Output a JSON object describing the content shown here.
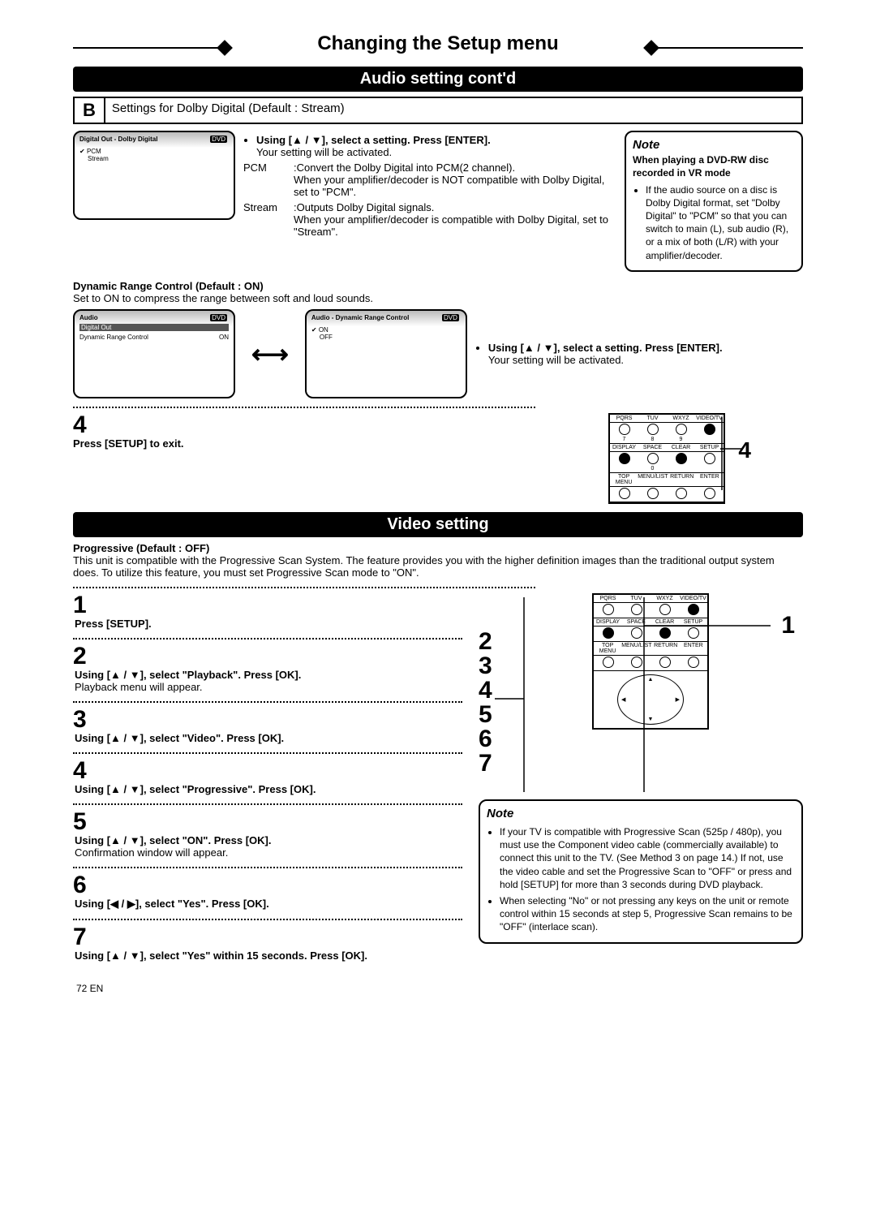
{
  "banner_title": "Changing the Setup menu",
  "section_audio": "Audio setting cont'd",
  "section_video": "Video setting",
  "b_letter": "B",
  "b_title": "Settings for Dolby Digital (Default : Stream)",
  "instr1_line1": "Using [▲ / ▼], select a setting. Press [ENTER].",
  "instr1_line2": "Your setting will be activated.",
  "pcm_label": "PCM",
  "pcm_desc": ":Convert the Dolby Digital into PCM(2 channel).\nWhen your amplifier/decoder is NOT compatible with Dolby Digital, set to \"PCM\".",
  "stream_label": "Stream",
  "stream_desc": ":Outputs Dolby Digital signals.\nWhen your amplifier/decoder is compatible with Dolby Digital, set to \"Stream\".",
  "note_title": "Note",
  "note_audio_heading": "When playing a DVD-RW disc recorded in VR mode",
  "note_audio_body": "If the audio source on a disc is Dolby Digital format, set \"Dolby Digital\" to \"PCM\" so that you can switch to main (L), sub audio (R), or a mix of both (L/R) with your amplifier/decoder.",
  "ss1": {
    "title": "Digital Out - Dolby Digital",
    "tag": "DVD",
    "opt1": "PCM",
    "opt2": "Stream"
  },
  "drc_heading": "Dynamic Range Control (Default : ON)",
  "drc_body": "Set to ON to compress the range between soft and loud sounds.",
  "ss2": {
    "title": "Audio",
    "tag": "DVD",
    "r1a": "Digital Out",
    "r1b": "",
    "r2a": "Dynamic Range Control",
    "r2b": "ON"
  },
  "ss3": {
    "title": "Audio - Dynamic Range Control",
    "tag": "DVD",
    "opt1": "ON",
    "opt2": "OFF"
  },
  "drc_instr1": "Using [▲ / ▼], select a setting. Press [ENTER].",
  "drc_instr2": "Your setting will be activated.",
  "step4_num": "4",
  "step4_text": "Press [SETUP] to exit.",
  "callout_4a": "4",
  "remote_labels": {
    "r1": [
      "PQRS",
      "TUV",
      "WXYZ",
      "VIDEO/TV"
    ],
    "r1n": [
      "7",
      "8",
      "9",
      ""
    ],
    "r2": [
      "DISPLAY",
      "SPACE",
      "CLEAR",
      "SETUP"
    ],
    "r2n": [
      "",
      "0",
      "",
      ""
    ],
    "r3": [
      "TOP MENU",
      "MENU/LIST",
      "RETURN",
      "ENTER"
    ]
  },
  "prog_heading": "Progressive (Default : OFF)",
  "prog_body": "This unit is compatible with the Progressive Scan System. The feature provides you with the higher definition images than the traditional output system does. To utilize this feature, you must set Progressive Scan mode to \"ON\".",
  "steps": {
    "s1n": "1",
    "s1b": "Press [SETUP].",
    "s2n": "2",
    "s2b": "Using [▲ / ▼], select \"Playback\". Press [OK].",
    "s2d": "Playback menu will appear.",
    "s3n": "3",
    "s3b": "Using [▲ / ▼], select \"Video\". Press [OK].",
    "s4n": "4",
    "s4b": "Using [▲ / ▼], select \"Progressive\". Press [OK].",
    "s5n": "5",
    "s5b": "Using [▲ / ▼], select \"ON\". Press [OK].",
    "s5d": "Confirmation window will appear.",
    "s6n": "6",
    "s6b": "Using [◀ / ▶], select \"Yes\". Press [OK].",
    "s7n": "7",
    "s7b": "Using [▲ / ▼], select \"Yes\" within 15 seconds. Press [OK]."
  },
  "callouts_video": [
    "1",
    "2",
    "3",
    "4",
    "5",
    "6",
    "7"
  ],
  "note_video_b1": "If your TV is compatible with Progressive Scan (525p / 480p), you must use the Component video cable (commercially available) to connect this unit to the TV. (See Method 3 on page 14.) If not, use the video cable and set the Progressive Scan to \"OFF\" or press and hold [SETUP] for more than 3 seconds during DVD playback.",
  "note_video_b2": "When selecting \"No\" or not pressing any keys on the unit or remote control within 15 seconds at step 5, Progressive Scan remains to be \"OFF\" (interlace scan).",
  "setup_bold": "[SETUP]",
  "page_footer": "72   EN"
}
